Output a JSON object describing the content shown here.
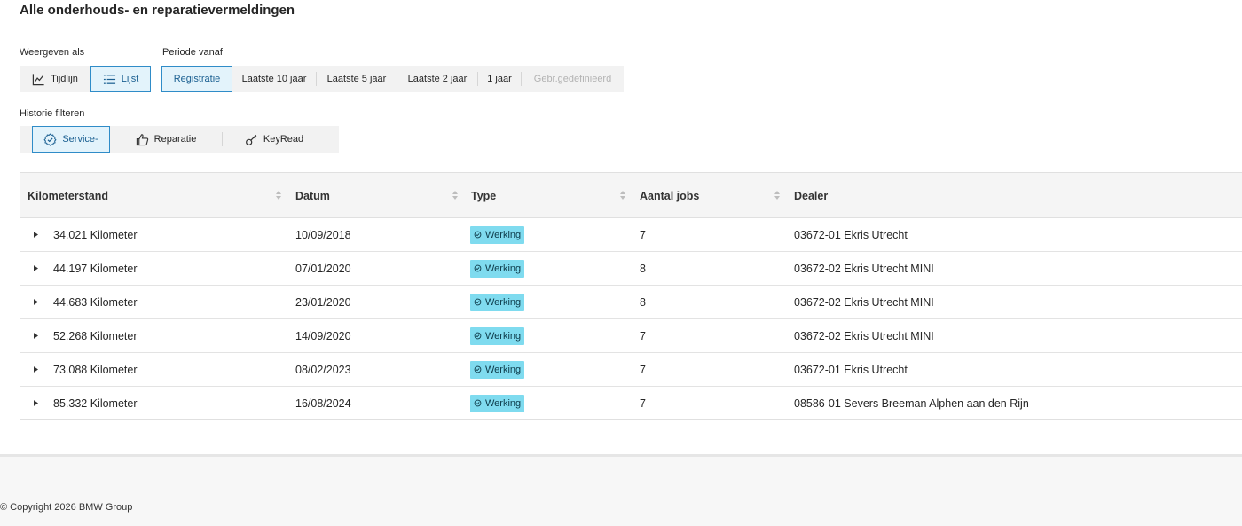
{
  "page": {
    "title": "Alle onderhouds- en reparatievermeldingen"
  },
  "view": {
    "label": "Weergeven als",
    "options": [
      {
        "label": "Tijdlijn",
        "icon": "line-chart-icon",
        "active": false
      },
      {
        "label": "Lijst",
        "icon": "list-icon",
        "active": true
      }
    ]
  },
  "period": {
    "label": "Periode vanaf",
    "options": [
      {
        "label": "Registratie",
        "active": true,
        "disabled": false
      },
      {
        "label": "Laatste 10 jaar",
        "active": false,
        "disabled": false
      },
      {
        "label": "Laatste 5 jaar",
        "active": false,
        "disabled": false
      },
      {
        "label": "Laatste 2 jaar",
        "active": false,
        "disabled": false
      },
      {
        "label": "1 jaar",
        "active": false,
        "disabled": false
      },
      {
        "label": "Gebr.gedefinieerd",
        "active": false,
        "disabled": true
      }
    ]
  },
  "filter": {
    "label": "Historie filteren",
    "options": [
      {
        "label": "Service-",
        "icon": "service-gear-icon",
        "active": true
      },
      {
        "label": "Reparatie",
        "icon": "thumbs-up-icon",
        "active": false
      },
      {
        "label": "KeyRead",
        "icon": "key-icon",
        "active": false
      }
    ]
  },
  "table": {
    "columns": [
      "Kilometerstand",
      "Datum",
      "Type",
      "Aantal jobs",
      "Dealer"
    ],
    "rows": [
      {
        "km": "34.021 Kilometer",
        "date": "10/09/2018",
        "type": "Werking",
        "jobs": "7",
        "dealer": "03672-01 Ekris Utrecht"
      },
      {
        "km": "44.197 Kilometer",
        "date": "07/01/2020",
        "type": "Werking",
        "jobs": "8",
        "dealer": "03672-02 Ekris Utrecht MINI"
      },
      {
        "km": "44.683 Kilometer",
        "date": "23/01/2020",
        "type": "Werking",
        "jobs": "8",
        "dealer": "03672-02 Ekris Utrecht MINI"
      },
      {
        "km": "52.268 Kilometer",
        "date": "14/09/2020",
        "type": "Werking",
        "jobs": "7",
        "dealer": "03672-02 Ekris Utrecht MINI"
      },
      {
        "km": "73.088 Kilometer",
        "date": "08/02/2023",
        "type": "Werking",
        "jobs": "7",
        "dealer": "03672-01 Ekris Utrecht"
      },
      {
        "km": "85.332 Kilometer",
        "date": "16/08/2024",
        "type": "Werking",
        "jobs": "7",
        "dealer": "08586-01 Severs Breeman Alphen aan den Rijn"
      }
    ]
  },
  "colors": {
    "accent": "#2f8cc8",
    "badge": "#7fdbef"
  },
  "footer": {
    "copyright": "© Copyright 2026 BMW Group"
  }
}
